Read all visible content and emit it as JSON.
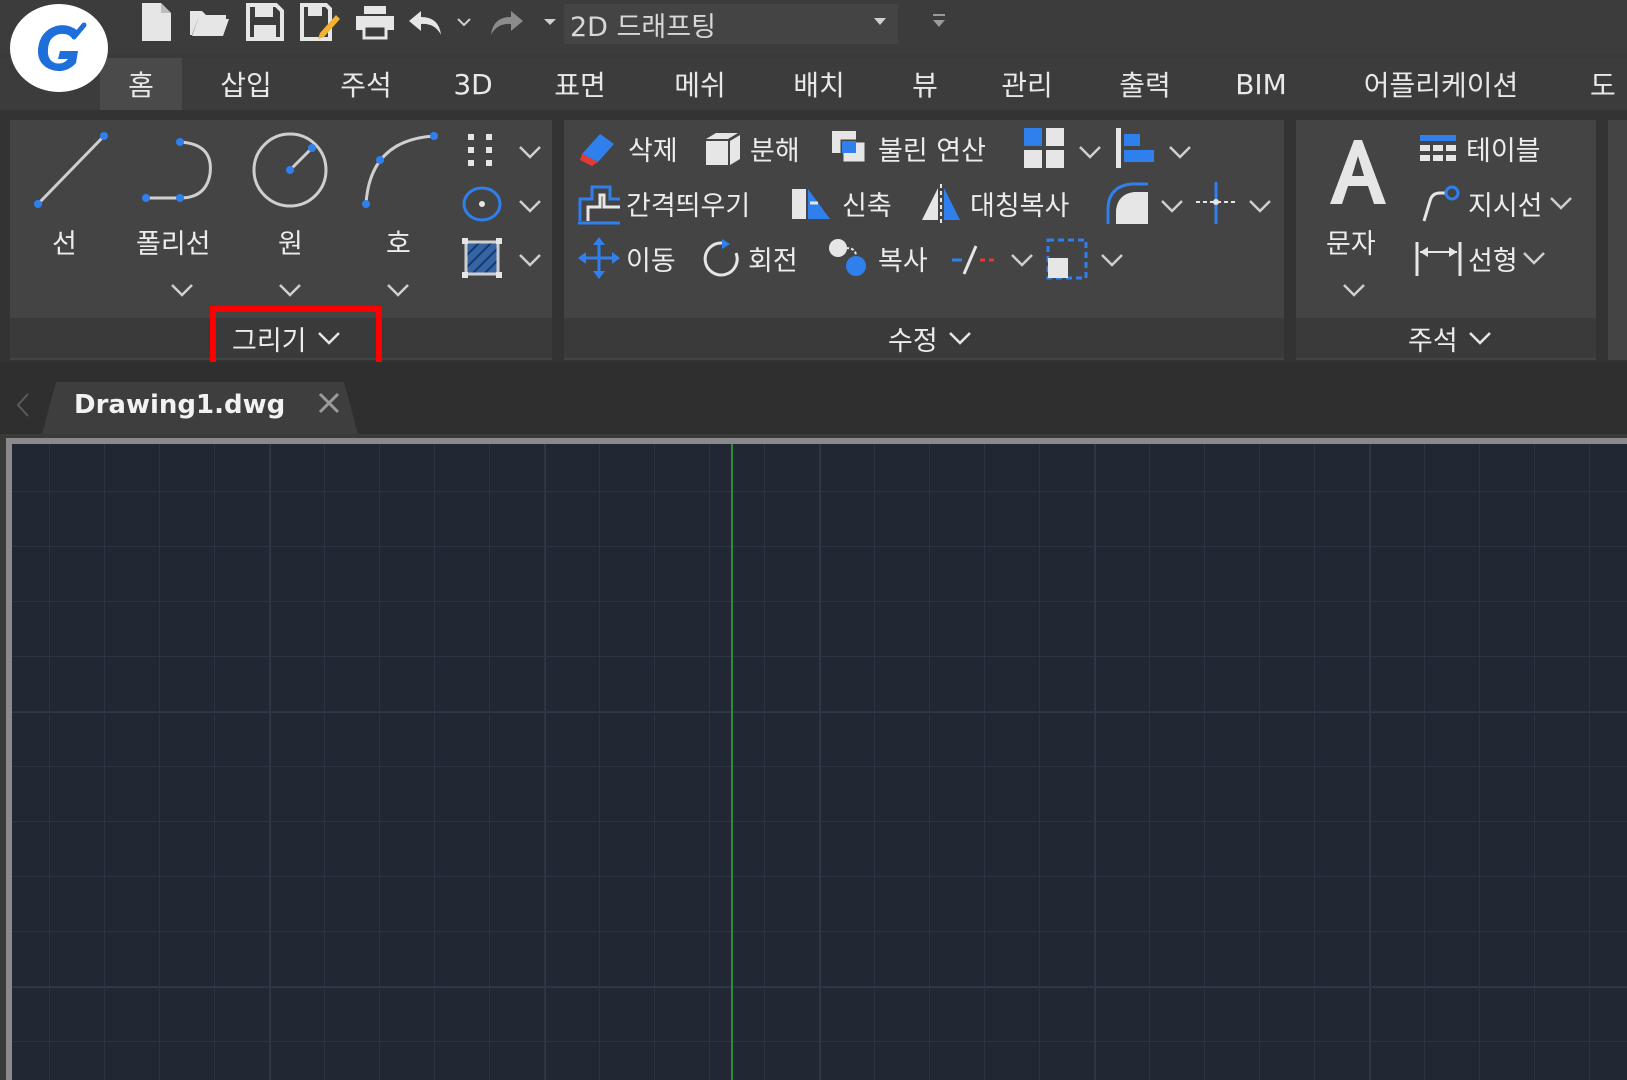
{
  "workspace": {
    "label": "2D 드래프팅"
  },
  "menu": {
    "tabs": [
      "홈",
      "삽입",
      "주석",
      "3D",
      "표면",
      "메쉬",
      "배치",
      "뷰",
      "관리",
      "출력",
      "BIM",
      "어플리케이션",
      "도"
    ]
  },
  "draw_panel": {
    "title": "그리기",
    "tools": {
      "line": "선",
      "polyline": "폴리선",
      "circle": "원",
      "arc": "호"
    }
  },
  "modify_panel": {
    "title": "수정",
    "tools": {
      "erase": "삭제",
      "explode": "분해",
      "boolean": "불린 연산",
      "offset": "간격띄우기",
      "stretch": "신축",
      "mirror": "대칭복사",
      "move": "이동",
      "rotate": "회전",
      "copy": "복사"
    }
  },
  "annotation_panel": {
    "title": "주석",
    "tools": {
      "text": "문자",
      "table": "테이블",
      "leader": "지시선",
      "linear": "선형"
    }
  },
  "document": {
    "tab_title": "Drawing1.dwg"
  },
  "colors": {
    "accent_blue": "#2f80ed",
    "highlight_red": "#ff0000",
    "canvas_bg": "#212833",
    "y_axis": "#2f8a3a"
  }
}
